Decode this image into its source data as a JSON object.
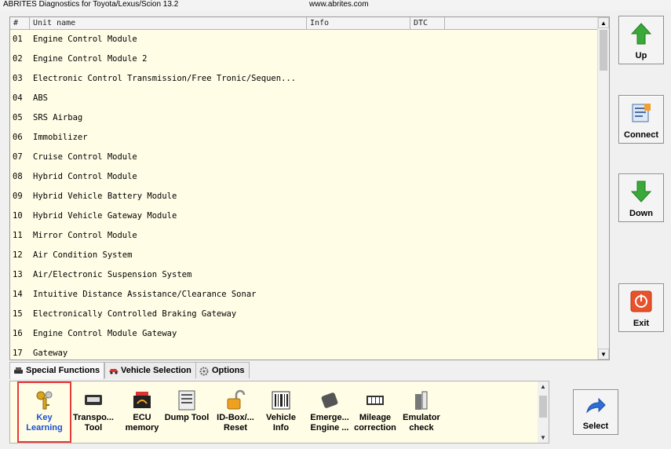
{
  "window": {
    "title": "ABRITES Diagnostics for Toyota/Lexus/Scion 13.2",
    "url": "www.abrites.com"
  },
  "table": {
    "columns": [
      "#",
      "Unit name",
      "Info",
      "DTC"
    ],
    "rows": [
      {
        "num": "01",
        "name": "Engine Control Module"
      },
      {
        "num": "02",
        "name": "Engine Control Module 2"
      },
      {
        "num": "03",
        "name": "Electronic Control Transmission/Free Tronic/Sequen..."
      },
      {
        "num": "04",
        "name": "ABS"
      },
      {
        "num": "05",
        "name": "SRS Airbag"
      },
      {
        "num": "06",
        "name": "Immobilizer"
      },
      {
        "num": "07",
        "name": "Cruise Control Module"
      },
      {
        "num": "08",
        "name": "Hybrid Control Module"
      },
      {
        "num": "09",
        "name": "Hybrid Vehicle Battery Module"
      },
      {
        "num": "10",
        "name": "Hybrid Vehicle Gateway Module"
      },
      {
        "num": "11",
        "name": "Mirror Control Module"
      },
      {
        "num": "12",
        "name": "Air Condition System"
      },
      {
        "num": "13",
        "name": "Air/Electronic Suspension System"
      },
      {
        "num": "14",
        "name": "Intuitive Distance Assistance/Clearance Sonar"
      },
      {
        "num": "15",
        "name": "Electronically Controlled Braking Gateway"
      },
      {
        "num": "16",
        "name": "Engine Control Module Gateway"
      },
      {
        "num": "17",
        "name": "Gateway"
      }
    ]
  },
  "side_buttons": {
    "up": "Up",
    "connect": "Connect",
    "down": "Down",
    "exit": "Exit",
    "select": "Select"
  },
  "tabs": [
    "Special Functions",
    "Vehicle Selection",
    "Options"
  ],
  "tools": [
    {
      "line1": "Key",
      "line2": "Learning",
      "icon": "keys-icon"
    },
    {
      "line1": "Transpo...",
      "line2": "Tool",
      "icon": "transponder-icon"
    },
    {
      "line1": "ECU",
      "line2": "memory",
      "icon": "ecu-chip-icon"
    },
    {
      "line1": "Dump Tool",
      "line2": "",
      "icon": "dump-file-icon"
    },
    {
      "line1": "ID-Box/...",
      "line2": "Reset",
      "icon": "padlock-icon"
    },
    {
      "line1": "Vehicle",
      "line2": "Info",
      "icon": "barcode-icon"
    },
    {
      "line1": "Emerge...",
      "line2": "Engine ...",
      "icon": "card-key-icon"
    },
    {
      "line1": "Mileage",
      "line2": "correction",
      "icon": "odometer-icon"
    },
    {
      "line1": "Emulator",
      "line2": "check",
      "icon": "emulator-icon"
    }
  ],
  "colors": {
    "list_background": "#fffde6",
    "selection_outline": "#e53a3a",
    "selected_text": "#1a4fd0",
    "arrow_green": "#3aa93a",
    "exit_orange": "#e8522a"
  }
}
